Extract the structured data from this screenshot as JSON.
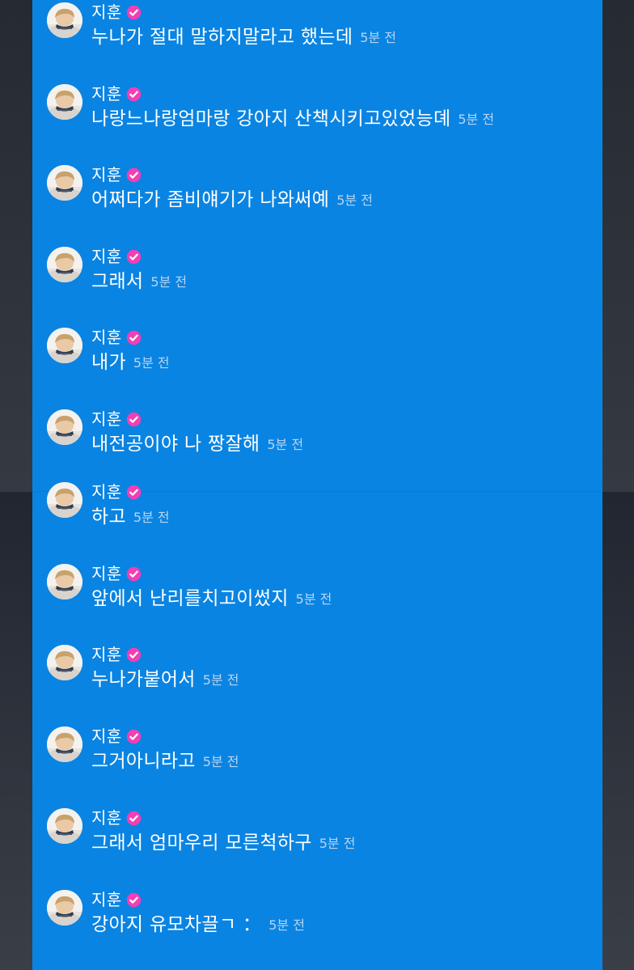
{
  "colors": {
    "panel_bg": "#0a84e2",
    "outside_bg": "#2c3037",
    "text": "#ffffff",
    "timestamp": "#b7d5f2",
    "verified_badge": "#f13fb5"
  },
  "messages": [
    {
      "author": "지훈",
      "verified_icon": "verified-check-icon",
      "text": "누나가 절대 말하지말라고 했는데",
      "time": "5분 전"
    },
    {
      "author": "지훈",
      "verified_icon": "verified-check-icon",
      "text": "나랑느나랑엄마랑 강아지 산책시키고있었능뎨",
      "time": "5분 전"
    },
    {
      "author": "지훈",
      "verified_icon": "verified-check-icon",
      "text": "어쩌다가 좀비얘기가 나와써예",
      "time": "5분 전"
    },
    {
      "author": "지훈",
      "verified_icon": "verified-check-icon",
      "text": "그래서",
      "time": "5분 전"
    },
    {
      "author": "지훈",
      "verified_icon": "verified-check-icon",
      "text": "내가",
      "time": "5분 전"
    },
    {
      "author": "지훈",
      "verified_icon": "verified-check-icon",
      "text": "내전공이야 나 짱잘해",
      "time": "5분 전"
    },
    {
      "author": "지훈",
      "verified_icon": "verified-check-icon",
      "text": "하고",
      "time": "5분 전"
    },
    {
      "author": "지훈",
      "verified_icon": "verified-check-icon",
      "text": "앞에서 난리를치고이썼지",
      "time": "5분 전"
    },
    {
      "author": "지훈",
      "verified_icon": "verified-check-icon",
      "text": "누나가붙어서",
      "time": "5분 전"
    },
    {
      "author": "지훈",
      "verified_icon": "verified-check-icon",
      "text": "그거아니라고",
      "time": "5분 전"
    },
    {
      "author": "지훈",
      "verified_icon": "verified-check-icon",
      "text": "그래서 엄마우리 모른척하구",
      "time": "5분 전"
    },
    {
      "author": "지훈",
      "verified_icon": "verified-check-icon",
      "text": "강아지 유모차끌ㄱ ：",
      "time": "5분 전"
    }
  ]
}
